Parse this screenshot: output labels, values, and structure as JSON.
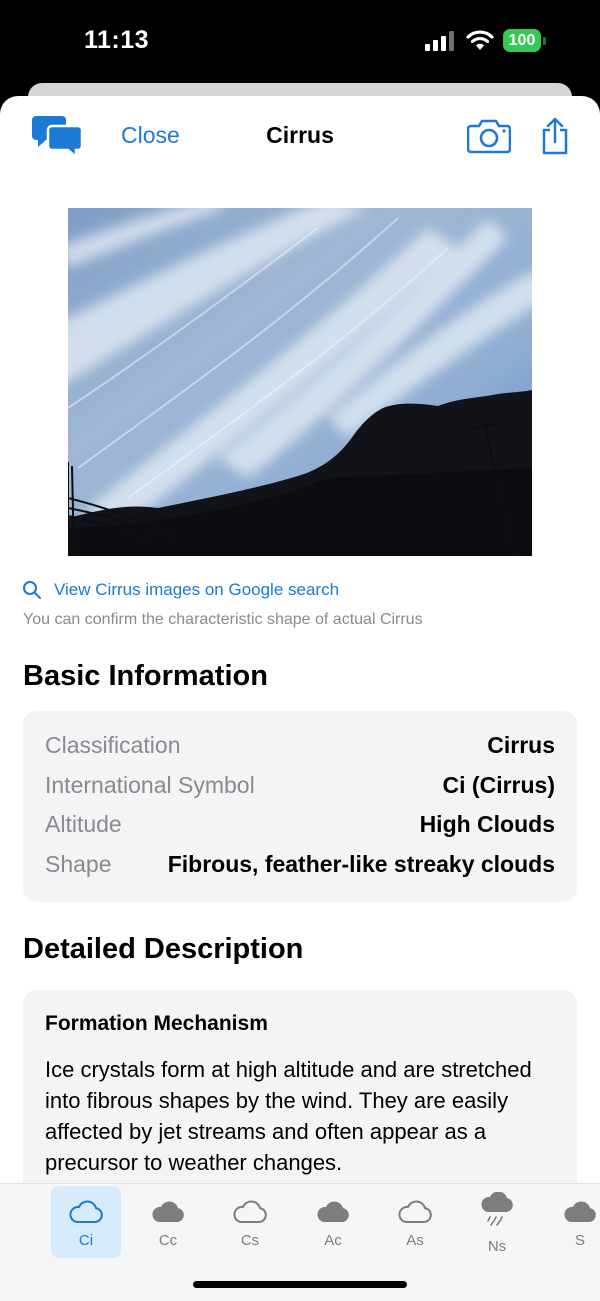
{
  "status": {
    "time": "11:13",
    "battery": "100"
  },
  "nav": {
    "close_label": "Close",
    "title": "Cirrus"
  },
  "search": {
    "link_text": "View Cirrus images on Google search",
    "hint": "You can confirm the characteristic shape of actual Cirrus"
  },
  "basic": {
    "heading": "Basic Information",
    "rows": [
      {
        "label": "Classification",
        "value": "Cirrus"
      },
      {
        "label": "International Symbol",
        "value": "Ci (Cirrus)"
      },
      {
        "label": "Altitude",
        "value": "High Clouds"
      },
      {
        "label": "Shape",
        "value": "Fibrous, feather-like streaky clouds"
      }
    ]
  },
  "detail": {
    "heading": "Detailed Description",
    "card_title": "Formation Mechanism",
    "card_text": "Ice crystals form at high altitude and are stretched into fibrous shapes by the wind. They are easily affected by jet streams and often appear as a precursor to weather changes."
  },
  "tabs": [
    {
      "label": "Ci",
      "icon": "cloud-outline-icon",
      "active": true
    },
    {
      "label": "Cc",
      "icon": "cloud-filled-icon"
    },
    {
      "label": "Cs",
      "icon": "cloud-outline-icon"
    },
    {
      "label": "Ac",
      "icon": "cloud-filled-icon"
    },
    {
      "label": "As",
      "icon": "cloud-outline-icon"
    },
    {
      "label": "Ns",
      "icon": "cloud-rain-icon"
    },
    {
      "label": "S",
      "icon": "cloud-filled-icon"
    }
  ],
  "colors": {
    "accent": "#1a7ad4",
    "battery": "#34c759",
    "active_tab_bg": "#d6ecfa"
  }
}
